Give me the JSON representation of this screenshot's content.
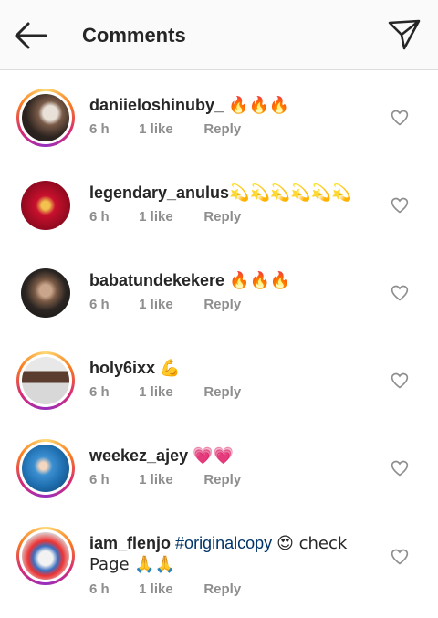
{
  "header": {
    "title": "Comments"
  },
  "comments": [
    {
      "username": "daniieloshinuby_",
      "text": "🔥🔥🔥",
      "time": "6 h",
      "likes": "1 like",
      "reply": "Reply"
    },
    {
      "username": "legendary_anulus",
      "text": "💫💫💫💫💫💫",
      "time": "6 h",
      "likes": "1 like",
      "reply": "Reply"
    },
    {
      "username": "babatundekekere",
      "text": "🔥🔥🔥",
      "time": "6 h",
      "likes": "1 like",
      "reply": "Reply"
    },
    {
      "username": "holy6ixx",
      "text": "💪",
      "time": "6 h",
      "likes": "1 like",
      "reply": "Reply"
    },
    {
      "username": "weekez_ajey",
      "text": "💗💗",
      "time": "6 h",
      "likes": "1 like",
      "reply": "Reply"
    },
    {
      "username": "iam_flenjo",
      "hashtag": "#originalcopy",
      "text": "😍 check Page 🙏🙏",
      "time": "6 h",
      "likes": "1 like",
      "reply": "Reply"
    }
  ],
  "colors": {
    "story_ring": "#d62976",
    "meta_text": "#8e8e8e",
    "hashtag": "#003569"
  },
  "icons": {
    "back": "arrow-left-icon",
    "send": "paper-plane-icon",
    "like": "heart-outline-icon"
  }
}
